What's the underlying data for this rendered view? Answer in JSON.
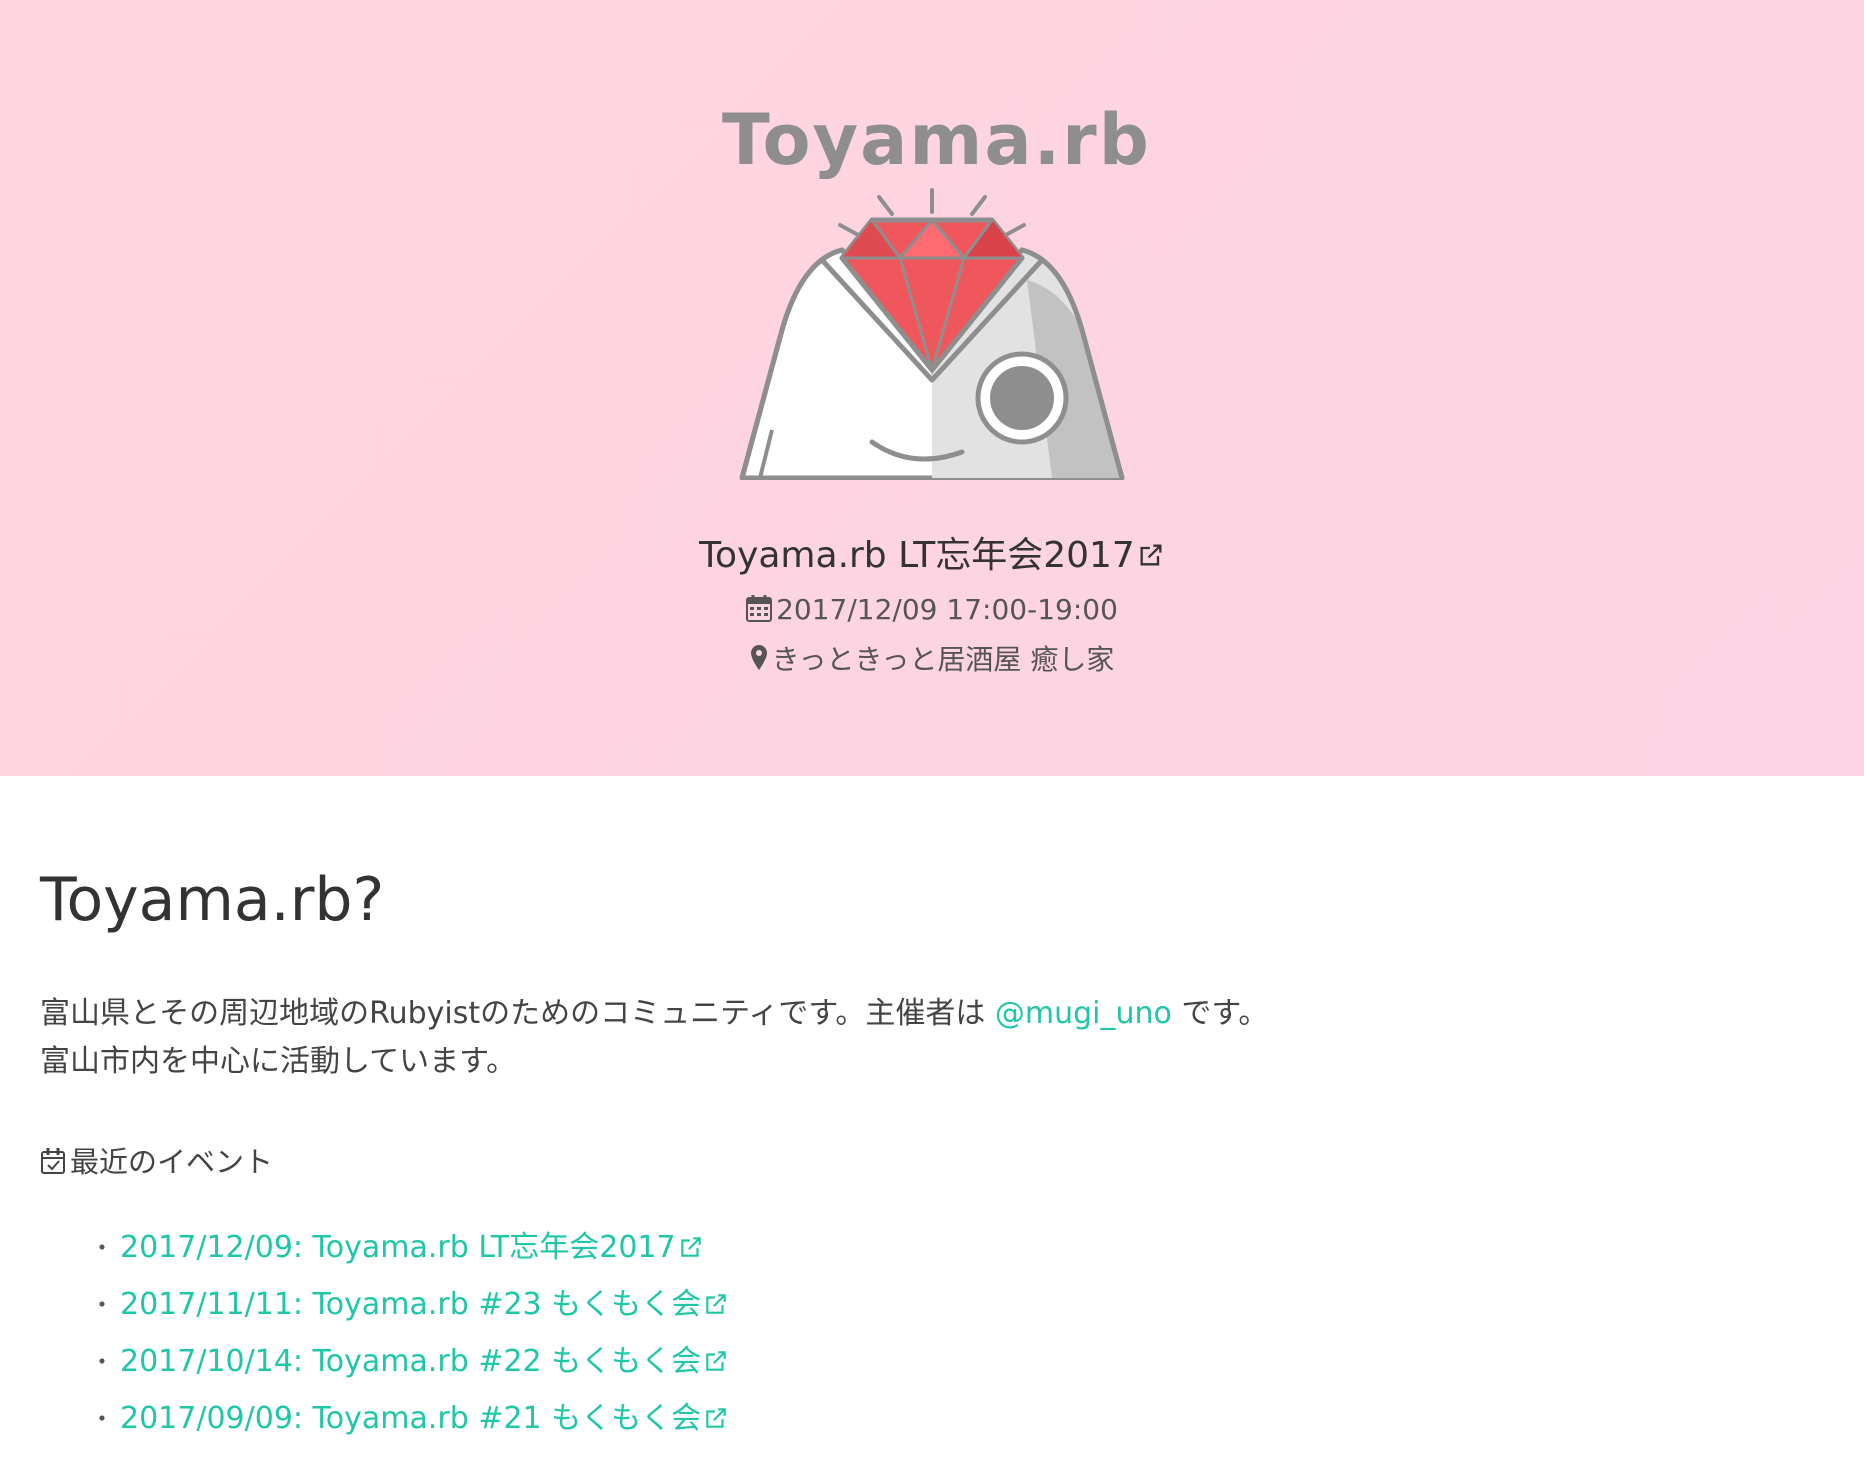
{
  "hero": {
    "logo_text": "Toyama.rb",
    "event_title": "Toyama.rb LT忘年会2017",
    "event_datetime": "2017/12/09 17:00-19:00",
    "event_place": "きっときっと居酒屋 癒し家"
  },
  "about": {
    "heading": "Toyama.rb?",
    "line1_before": "富山県とその周辺地域のRubyistのためのコミュニティです。主催者は ",
    "organizer_link": "@mugi_uno",
    "line1_after": " です。",
    "line2": "富山市内を中心に活動しています。"
  },
  "events": {
    "heading": "最近のイベント",
    "items": [
      {
        "label": "2017/12/09: Toyama.rb LT忘年会2017"
      },
      {
        "label": "2017/11/11: Toyama.rb #23 もくもく会"
      },
      {
        "label": "2017/10/14: Toyama.rb #22 もくもく会"
      },
      {
        "label": "2017/09/09: Toyama.rb #21 もくもく会"
      }
    ],
    "bullet": "・"
  },
  "colors": {
    "hero_bg": "#ffd5e0",
    "link": "#1fc7a7",
    "ruby": "#f0575d",
    "logo_gray": "#8e8e8e"
  },
  "icons": {
    "external": "external-link-icon",
    "calendar": "calendar-icon",
    "location": "map-marker-icon",
    "events": "calendar-check-icon"
  }
}
